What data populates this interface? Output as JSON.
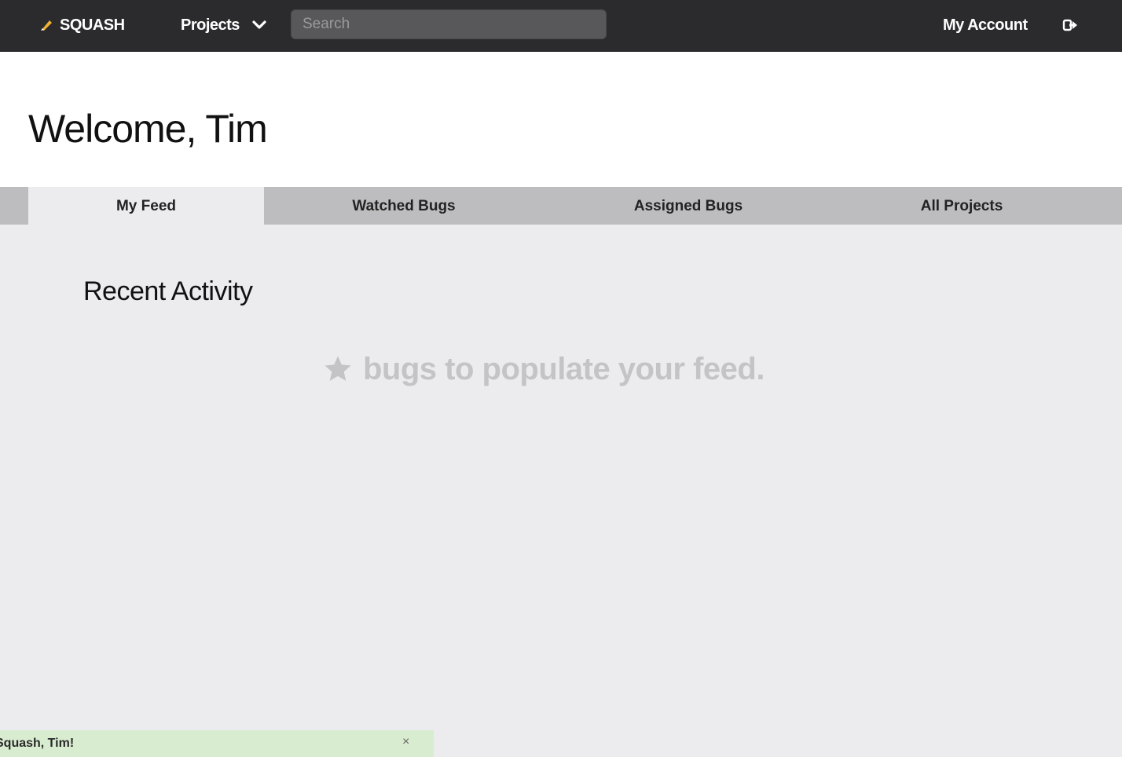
{
  "topbar": {
    "brand": "SQUASH",
    "projects_label": "Projects",
    "search_placeholder": "Search",
    "account_label": "My Account"
  },
  "header": {
    "welcome": "Welcome, Tim"
  },
  "tabs": [
    {
      "label": "My Feed",
      "active": true
    },
    {
      "label": "Watched Bugs",
      "active": false
    },
    {
      "label": "Assigned Bugs",
      "active": false
    },
    {
      "label": "All Projects",
      "active": false
    }
  ],
  "feed": {
    "heading": "Recent Activity",
    "empty_text": "bugs to populate your feed."
  },
  "flash": {
    "message": "Squash, Tim!",
    "close": "×"
  },
  "colors": {
    "topbar": "#2b2b2d",
    "accent": "#f2b132",
    "tabbar": "#bdbdbf",
    "flash": "#d8eccf"
  }
}
